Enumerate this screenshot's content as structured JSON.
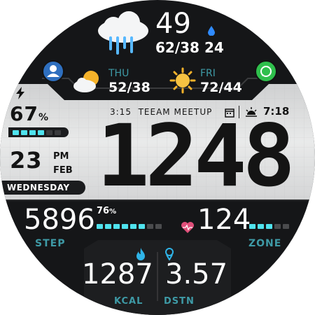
{
  "weather_now": {
    "icon": "rain-cloud-icon",
    "temperature": "49",
    "high_low": "62/38",
    "humidity": "24",
    "humidity_icon": "drop-icon"
  },
  "forecast": [
    {
      "day": "THU",
      "temps": "52/38",
      "icon": "partly-cloudy-icon"
    },
    {
      "day": "FRI",
      "temps": "72/44",
      "icon": "sun-icon"
    }
  ],
  "shortcuts": {
    "left": "contacts-app-icon",
    "right": "whatsapp-icon"
  },
  "battery": {
    "percent": "67",
    "unit": "%",
    "level": 0.67
  },
  "event": {
    "time": "3:15",
    "title": "TEEAM MEETUP"
  },
  "sunrise": {
    "time": "7:18"
  },
  "time": {
    "hours": "12",
    "minutes": "48",
    "ampm": "PM"
  },
  "date": {
    "day": "23",
    "month": "FEB",
    "weekday": "WEDNESDAY"
  },
  "steps": {
    "value": "5896",
    "percent": "76",
    "unit": "%",
    "label": "STEP",
    "progress": 0.76
  },
  "heart": {
    "value": "124",
    "label": "ZONE",
    "zone_level": 0.6
  },
  "calories": {
    "value": "1287",
    "label": "KCAL"
  },
  "distance": {
    "value": "3.57",
    "label": "DSTN"
  },
  "colors": {
    "accent": "#4fe3ee",
    "label": "#3e9aa6",
    "heart": "#e04f7a",
    "sun": "#f5b22a"
  }
}
